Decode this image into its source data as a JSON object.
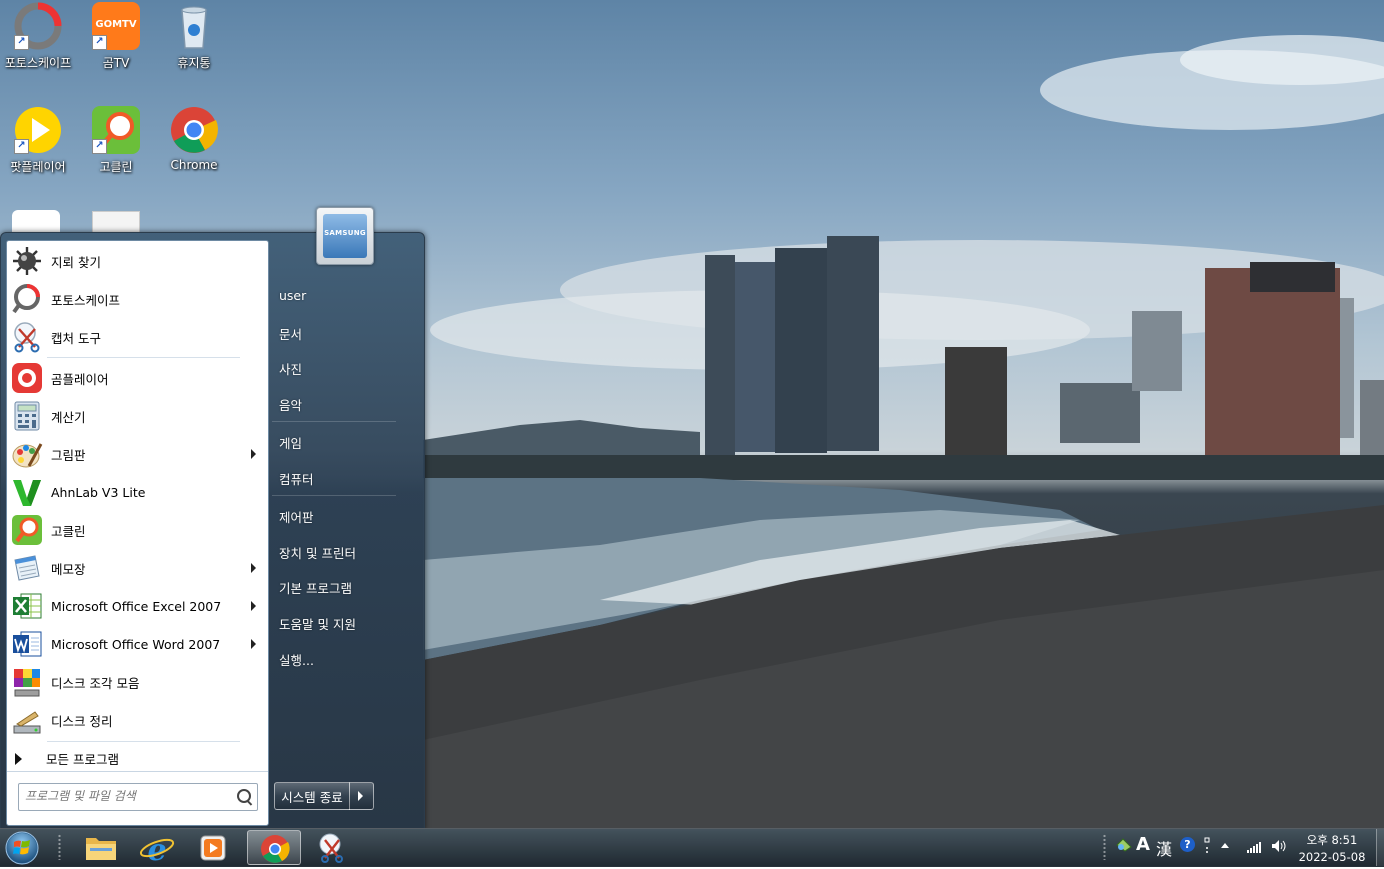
{
  "desktop": {
    "icons": [
      {
        "label": "포토스케이프",
        "icon": "photoscape-icon"
      },
      {
        "label": "곰TV",
        "icon": "gomtv-icon",
        "badge_text": "GOMTV"
      },
      {
        "label": "휴지통",
        "icon": "recycle-bin-icon"
      },
      {
        "label": "팟플레이어",
        "icon": "potplayer-icon"
      },
      {
        "label": "고클린",
        "icon": "goclean-icon"
      },
      {
        "label": "Chrome",
        "icon": "chrome-icon"
      }
    ]
  },
  "start_menu": {
    "programs": [
      {
        "label": "지뢰 찾기",
        "icon": "minesweeper-icon",
        "submenu": false
      },
      {
        "label": "포토스케이프",
        "icon": "photoscape-icon",
        "submenu": false
      },
      {
        "label": "캡처 도구",
        "icon": "snipping-tool-icon",
        "submenu": false
      },
      {
        "label": "곰플레이어",
        "icon": "gomplayer-icon",
        "submenu": false
      },
      {
        "label": "계산기",
        "icon": "calculator-icon",
        "submenu": false
      },
      {
        "label": "그림판",
        "icon": "paint-icon",
        "submenu": true
      },
      {
        "label": "AhnLab V3 Lite",
        "icon": "ahnlab-v3-icon",
        "submenu": false
      },
      {
        "label": "고클린",
        "icon": "goclean-icon",
        "submenu": false
      },
      {
        "label": "메모장",
        "icon": "notepad-icon",
        "submenu": true
      },
      {
        "label": "Microsoft Office Excel 2007",
        "icon": "excel-icon",
        "submenu": true
      },
      {
        "label": "Microsoft Office Word 2007",
        "icon": "word-icon",
        "submenu": true
      },
      {
        "label": "디스크 조각 모음",
        "icon": "defrag-icon",
        "submenu": false
      },
      {
        "label": "디스크 정리",
        "icon": "disk-cleanup-icon",
        "submenu": false
      }
    ],
    "all_programs_label": "모든 프로그램",
    "search_placeholder": "프로그램 및 파일 검색",
    "user_picture_brand": "SAMSUNG",
    "right_items": [
      {
        "label": "user"
      },
      {
        "label": "문서"
      },
      {
        "label": "사진"
      },
      {
        "label": "음악"
      },
      {
        "label": "게임"
      },
      {
        "label": "컴퓨터"
      },
      {
        "label": "제어판"
      },
      {
        "label": "장치 및 프린터"
      },
      {
        "label": "기본 프로그램"
      },
      {
        "label": "도움말 및 지원"
      },
      {
        "label": "실행..."
      }
    ],
    "shutdown_label": "시스템 종료"
  },
  "taskbar": {
    "pinned": [
      {
        "icon": "file-explorer-icon"
      },
      {
        "icon": "internet-explorer-icon"
      },
      {
        "icon": "media-player-icon"
      },
      {
        "icon": "chrome-icon",
        "active": true
      },
      {
        "icon": "snipping-tool-icon"
      }
    ],
    "tray": {
      "ime_mode": "A",
      "ime_hanja": "漢",
      "clock_time": "오후 8:51",
      "clock_date": "2022-05-08"
    }
  }
}
